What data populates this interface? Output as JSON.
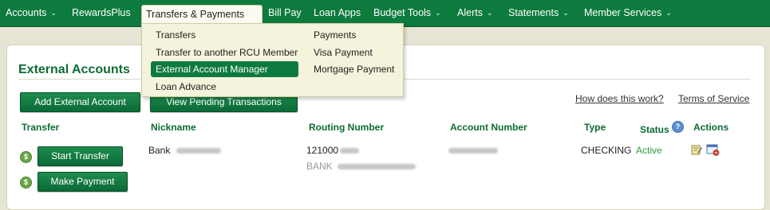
{
  "nav": {
    "items": [
      {
        "label": "Accounts",
        "has_chevron": true
      },
      {
        "label": "RewardsPlus",
        "has_chevron": false
      },
      {
        "label": "Transfers & Payments",
        "has_chevron": false
      },
      {
        "label": "Bill Pay",
        "has_chevron": false
      },
      {
        "label": "Loan Apps",
        "has_chevron": false
      },
      {
        "label": "Budget Tools",
        "has_chevron": true
      },
      {
        "label": "Alerts",
        "has_chevron": true
      },
      {
        "label": "Statements",
        "has_chevron": true
      },
      {
        "label": "Member Services",
        "has_chevron": true
      }
    ],
    "chevron": "⌄"
  },
  "dropdown": {
    "left": [
      "Transfers",
      "Transfer to another RCU Member",
      "External Account Manager",
      "Loan Advance"
    ],
    "right": [
      "Payments",
      "Visa Payment",
      "Mortgage Payment"
    ],
    "highlighted": "External Account Manager"
  },
  "page": {
    "title": "External Accounts",
    "add_button": "Add External Account",
    "pending_button": "View Pending Transactions",
    "help_link": "How does this work?",
    "terms_link": "Terms of Service"
  },
  "table": {
    "headers": {
      "transfer": "Transfer",
      "nickname": "Nickname",
      "routing": "Routing Number",
      "account": "Account Number",
      "type": "Type",
      "status": "Status",
      "actions": "Actions"
    },
    "row": {
      "nickname": "Bank",
      "routing": "121000",
      "routing_bank": "BANK",
      "type": "CHECKING",
      "status": "Active",
      "start_transfer": "Start Transfer",
      "make_payment": "Make Payment"
    }
  },
  "icons": {
    "dollar": "$",
    "help": "?"
  },
  "colors": {
    "brand_green": "#0d7a3e",
    "status_active": "#2d9c3c",
    "dropdown_bg": "#f4f3dc"
  }
}
